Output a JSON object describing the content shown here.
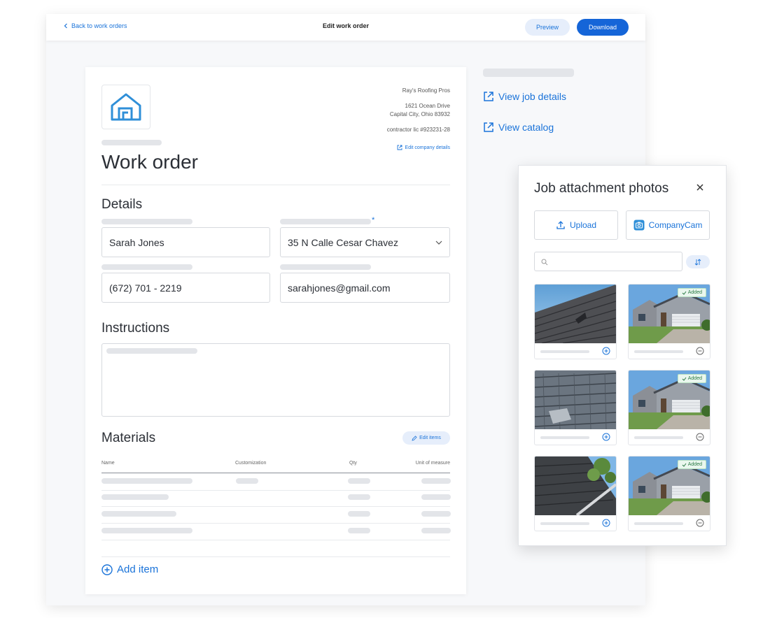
{
  "topbar": {
    "back_label": "Back to work orders",
    "title": "Edit work order",
    "preview_label": "Preview",
    "download_label": "Download"
  },
  "company": {
    "name": "Ray's Roofing Pros",
    "address_line1": "1621 Ocean Drive",
    "address_line2": "Capital City, Ohio 83932",
    "license": "contractor lic #923231-28",
    "edit_label": "Edit company details"
  },
  "document": {
    "title": "Work order",
    "details_heading": "Details",
    "fields": {
      "name": "Sarah Jones",
      "address": "35 N Calle Cesar Chavez",
      "phone": "(672) 701 - 2219",
      "email": "sarahjones@gmail.com"
    },
    "instructions_heading": "Instructions",
    "materials_heading": "Materials",
    "edit_items_label": "Edit items",
    "columns": [
      "Name",
      "Customization",
      "Qty",
      "Unit of measure"
    ],
    "add_item_label": "Add item"
  },
  "sidebar": {
    "view_job_label": "View job details",
    "view_catalog_label": "View catalog"
  },
  "panel": {
    "title": "Job attachment photos",
    "upload_label": "Upload",
    "companycam_label": "CompanyCam",
    "search_placeholder": "",
    "added_label": "Added",
    "photos": [
      {
        "subject": "roof-shingles-damaged",
        "added": false
      },
      {
        "subject": "house-front",
        "added": true
      },
      {
        "subject": "roof-shingles-torn",
        "added": false
      },
      {
        "subject": "house-front",
        "added": true
      },
      {
        "subject": "roof-gutter-tree",
        "added": false
      },
      {
        "subject": "house-front",
        "added": true
      }
    ]
  },
  "colors": {
    "accent": "#1a73d9",
    "primary_button": "#1565d8",
    "added_badge": "#2a7a45"
  }
}
